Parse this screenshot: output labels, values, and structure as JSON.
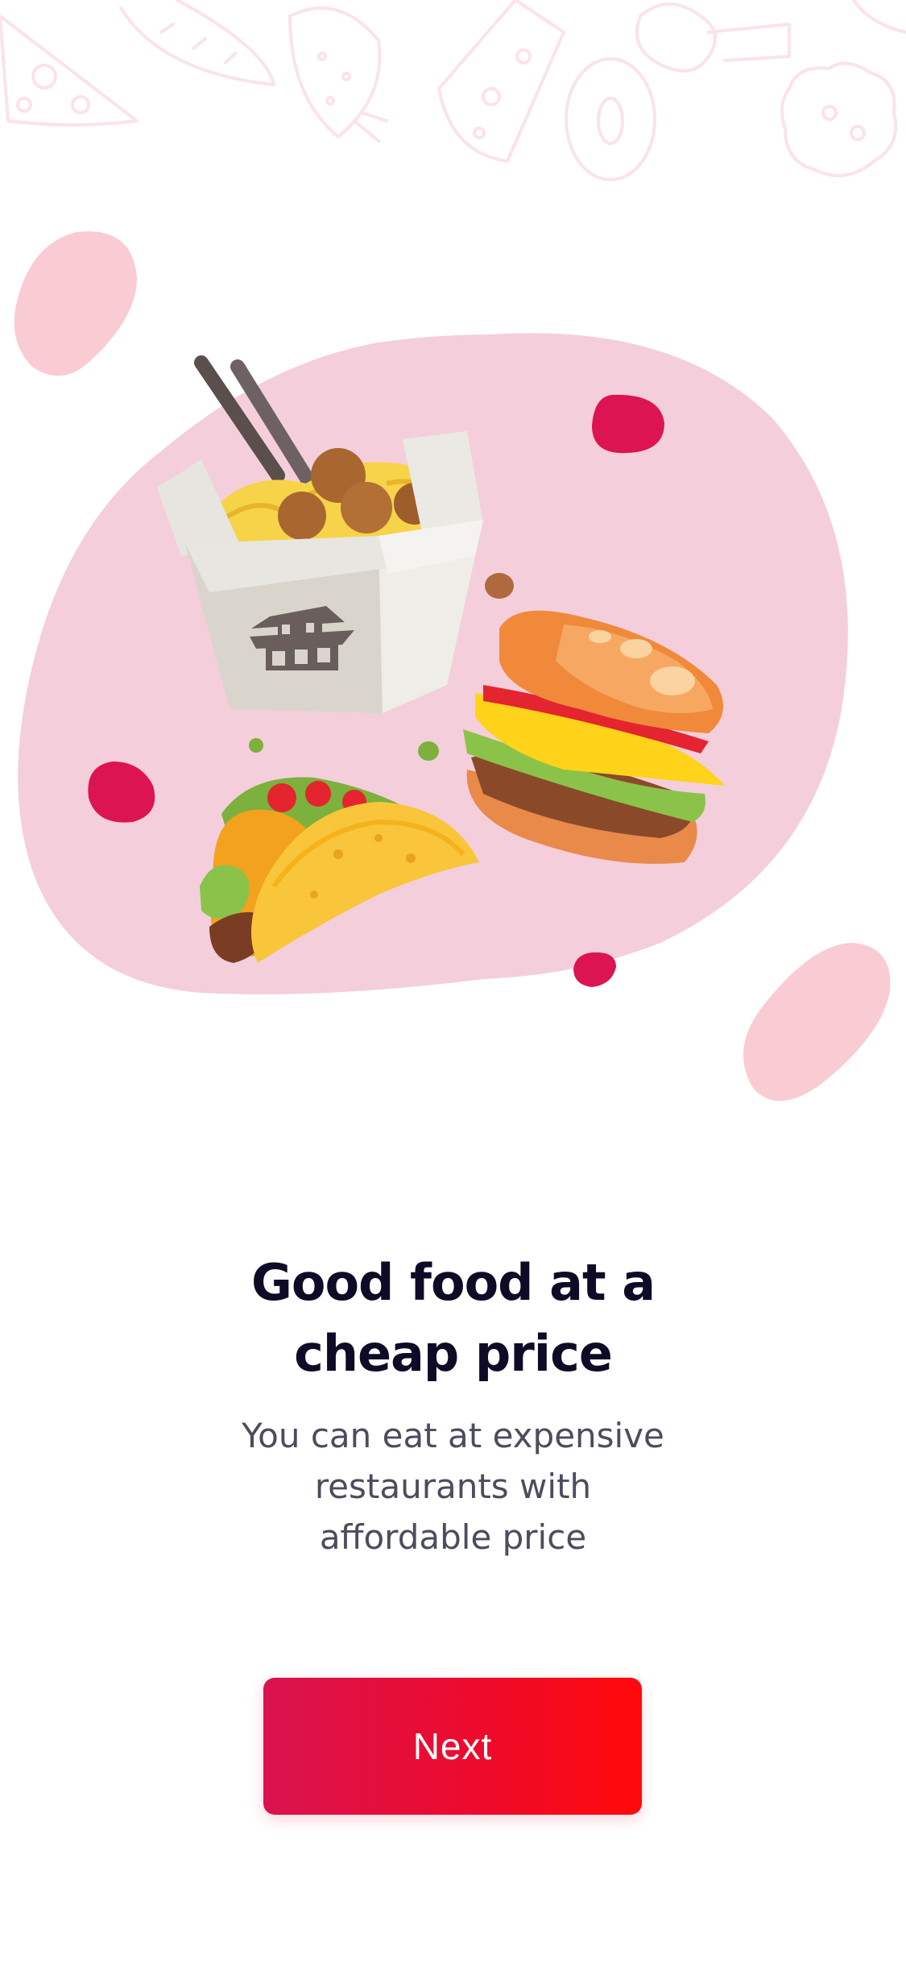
{
  "onboarding": {
    "title_line1": "Good food at a",
    "title_line2": "cheap price",
    "subtitle_line1": "You can eat at expensive",
    "subtitle_line2": "restaurants with",
    "subtitle_line3": "affordable price",
    "next_label": "Next"
  },
  "icons": {
    "background": "food-doodle-pattern",
    "illustration": "fast-food-illustration",
    "items": [
      "noodle-box-icon",
      "burger-icon",
      "taco-icon"
    ]
  },
  "colors": {
    "title": "#0d0b26",
    "subtitle": "#4b4d5e",
    "blob": "#f5cedb",
    "accent": "#dc1452",
    "button_start": "#d9134f",
    "button_end": "#ff0a0a",
    "button_text": "#ffffff"
  }
}
